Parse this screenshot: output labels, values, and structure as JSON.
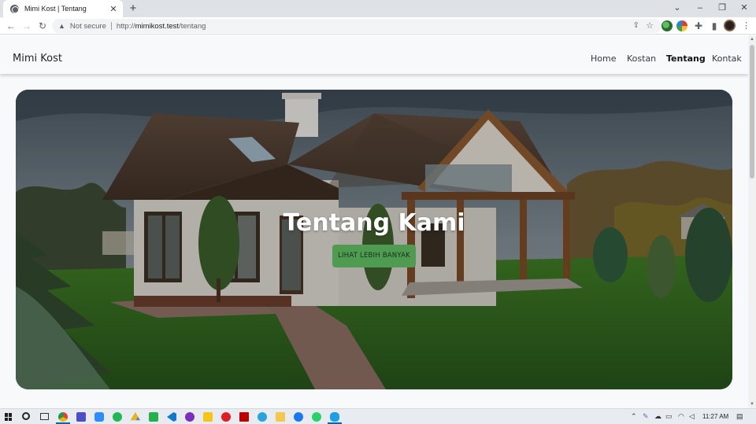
{
  "browser": {
    "tab_title": "Mimi Kost | Tentang",
    "tab_close": "✕",
    "new_tab": "+",
    "security_label": "Not secure",
    "url_scheme": "http://",
    "url_host": "mimikost.test",
    "url_path": "/tentang",
    "window_controls": {
      "dropdown": "⌄",
      "minimize": "–",
      "maximize": "❐",
      "close": "✕"
    }
  },
  "site": {
    "brand": "Mimi Kost",
    "nav": [
      {
        "label": "Home"
      },
      {
        "label": "Kostan"
      },
      {
        "label": "Tentang",
        "active": true
      },
      {
        "label": "Kontak"
      }
    ]
  },
  "hero": {
    "title": "Tentang Kami",
    "button": "LIHAT LEBIH BANYAK",
    "button_color": "#4f9b52"
  },
  "taskbar": {
    "clock": "11:27 AM",
    "pinned_icons": [
      "search-icon",
      "task-view-icon",
      "chrome-icon",
      "app-icon",
      "zoom-icon",
      "spotify-icon",
      "drive-icon",
      "app-icon",
      "vscode-icon",
      "app-icon",
      "notes-icon",
      "app-icon",
      "filezilla-icon",
      "telegram-icon",
      "file-explorer-icon",
      "messenger-icon",
      "whatsapp-icon",
      "app-icon"
    ]
  },
  "colors": {
    "accent": "#4f9b52",
    "nav_background": "#f8f9fa",
    "taskbar_active": "#0067c0"
  }
}
